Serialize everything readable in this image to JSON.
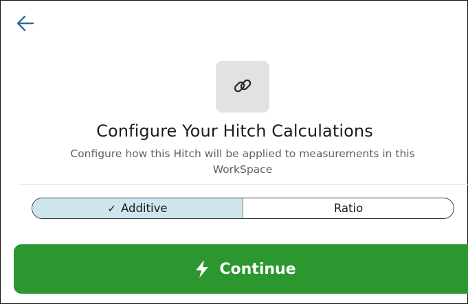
{
  "header": {
    "back_icon": "arrow-left-icon",
    "accent_color": "#2a6f97"
  },
  "hero": {
    "icon": "link-icon",
    "title": "Configure Your Hitch Calculations",
    "subtitle": "Configure how this Hitch will be applied to measurements in this WorkSpace"
  },
  "mode_toggle": {
    "options": [
      {
        "label": "Additive",
        "selected": true
      },
      {
        "label": "Ratio",
        "selected": false
      }
    ],
    "selected_color": "#cfe5ee"
  },
  "continue_button": {
    "label": "Continue",
    "icon": "lightning-bolt-icon",
    "color": "#2c962f"
  }
}
